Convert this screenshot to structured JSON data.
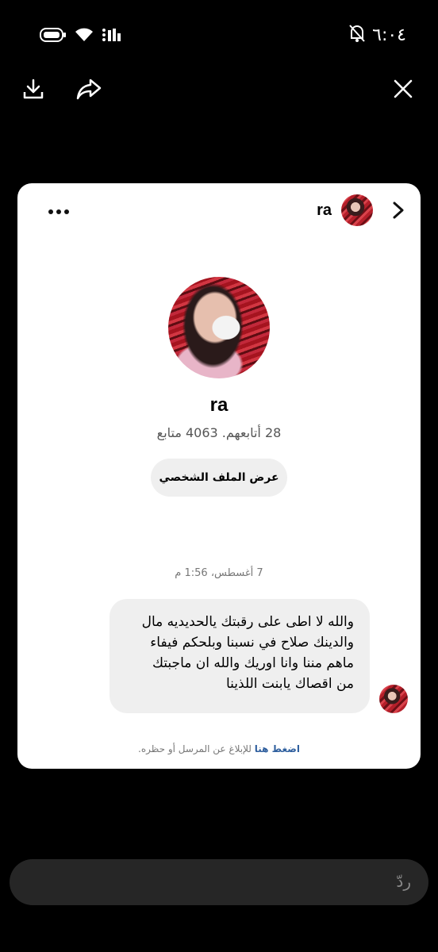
{
  "status_bar": {
    "time": "٦:٠٤"
  },
  "icons": {
    "download": "download-icon",
    "share": "share-icon",
    "close": "close-icon",
    "more": "more-icon",
    "chevron": "chevron-right-icon"
  },
  "card": {
    "header_name": "ra",
    "profile": {
      "name": "ra",
      "stats": "28 أتابعهم. 4063 متابع",
      "view_profile_label": "عرض الملف الشخصي"
    },
    "timestamp": "7 أغسطس، 1:56 م",
    "message": {
      "lines": [
        "والله لا اطى على رقبتك يالحديديه مال",
        "والدينك صلاح في نسبنا وبلحكم فيفاء",
        "ماهم مننا  وانا اوريك والله ان ماجبتك",
        "من اقصاك يابنت اللذينا"
      ]
    },
    "report": {
      "link": "اضغط هنا",
      "text": " للإبلاغ عن المرسل أو حظره."
    }
  },
  "reply": {
    "placeholder": "ردّ"
  },
  "colors": {
    "background": "#000000",
    "card": "#ffffff",
    "bubble": "#efefef",
    "link": "#2f5f9e",
    "reply_box": "#262626"
  }
}
